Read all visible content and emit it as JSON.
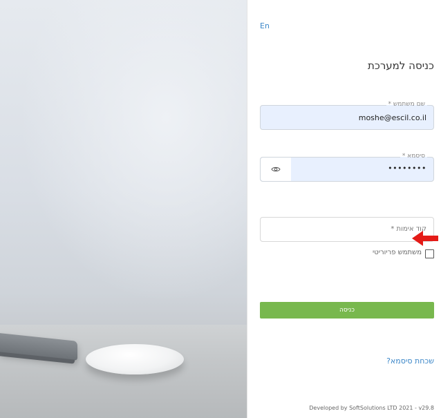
{
  "language_toggle": "En",
  "title": "כניסה למערכת",
  "username": {
    "label": "שם משתמש *",
    "value": "moshe@escil.co.il"
  },
  "password": {
    "label": "סיסמא *",
    "value": "••••••••"
  },
  "otp": {
    "placeholder": "קוד אימות *"
  },
  "priority_user": {
    "label": "משתמש פריוריטי"
  },
  "login_button": "כניסה",
  "forgot_password": "שכחת סיסמא?",
  "footer": "Developed by SoftSolutions LTD 2021 - v29.8",
  "icons": {
    "password_toggle": "eye-icon",
    "annotation": "red-arrow-icon"
  },
  "colors": {
    "accent_blue": "#3a86c8",
    "button_green": "#78b84e",
    "autofill_bg": "#e8f0fe",
    "annotation_red": "#e41b17"
  }
}
